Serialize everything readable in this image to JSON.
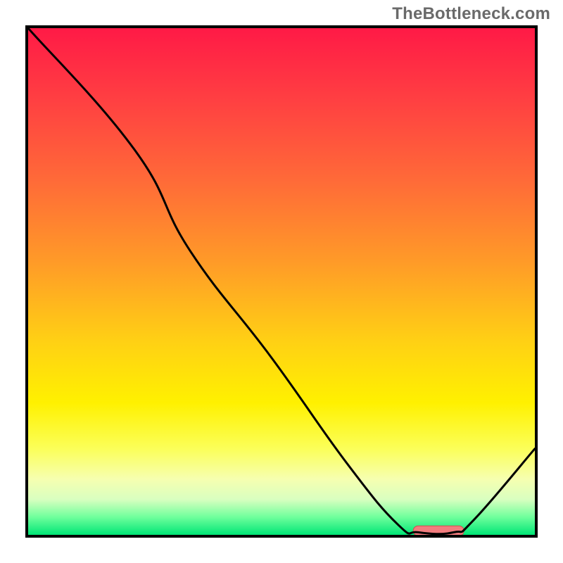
{
  "watermark": "TheBottleneck.com",
  "colors": {
    "border": "#000000",
    "text": "#6a6a6a",
    "curve": "#000000",
    "marker_fill": "#f27c7e",
    "marker_stroke": "#d24c4e",
    "gradient_stops": [
      {
        "offset": 0.0,
        "color": "#ff1a46"
      },
      {
        "offset": 0.14,
        "color": "#ff3f42"
      },
      {
        "offset": 0.3,
        "color": "#ff6a38"
      },
      {
        "offset": 0.46,
        "color": "#ff9a28"
      },
      {
        "offset": 0.62,
        "color": "#ffd114"
      },
      {
        "offset": 0.74,
        "color": "#fff100"
      },
      {
        "offset": 0.83,
        "color": "#fbff59"
      },
      {
        "offset": 0.89,
        "color": "#f6ffb0"
      },
      {
        "offset": 0.93,
        "color": "#d9ffc0"
      },
      {
        "offset": 0.965,
        "color": "#6fff9c"
      },
      {
        "offset": 1.0,
        "color": "#00e676"
      }
    ]
  },
  "chart_data": {
    "type": "line",
    "title": "",
    "xlabel": "",
    "ylabel": "",
    "xlim": [
      0,
      100
    ],
    "ylim": [
      0,
      100
    ],
    "series": [
      {
        "name": "curve",
        "points": [
          {
            "x": 0,
            "y": 100
          },
          {
            "x": 21,
            "y": 76
          },
          {
            "x": 32,
            "y": 56
          },
          {
            "x": 48,
            "y": 35
          },
          {
            "x": 63,
            "y": 14
          },
          {
            "x": 73,
            "y": 2
          },
          {
            "x": 77,
            "y": 0.5
          },
          {
            "x": 84,
            "y": 0.5
          },
          {
            "x": 88,
            "y": 3
          },
          {
            "x": 100,
            "y": 17
          }
        ]
      }
    ],
    "markers": [
      {
        "name": "valley-marker",
        "x_start": 76,
        "x_end": 86,
        "y": 0.8
      }
    ],
    "bands": []
  }
}
